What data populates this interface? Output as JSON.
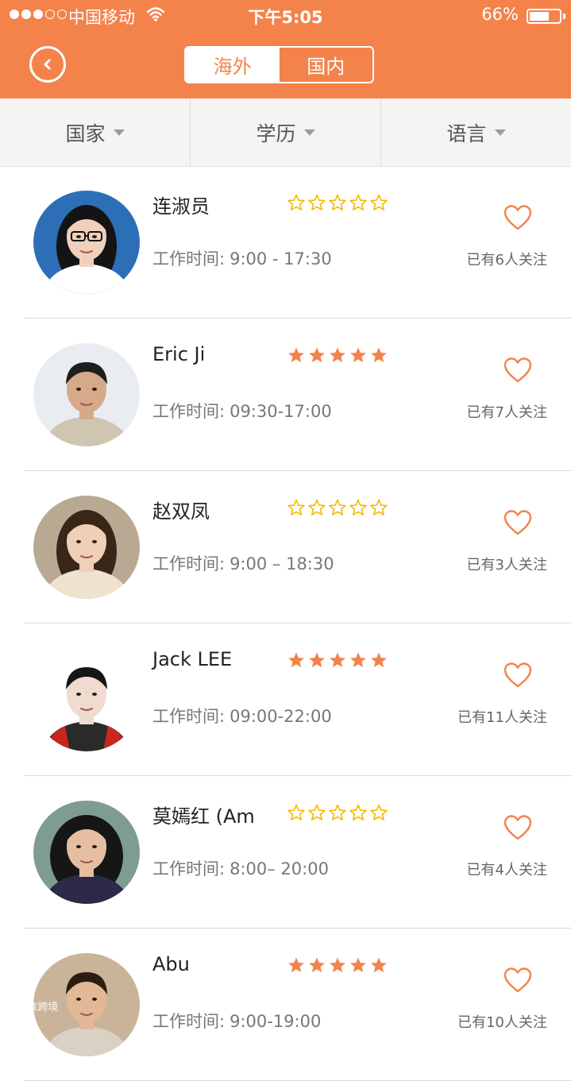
{
  "status_bar": {
    "carrier": "中国移动",
    "time": "下午5:05",
    "battery": "66%",
    "battery_level": 0.66,
    "signal_strength": 3,
    "signal_total": 5
  },
  "header": {
    "back_icon": "back-circle-icon",
    "tabs": [
      {
        "label": "海外",
        "active": true
      },
      {
        "label": "国内",
        "active": false
      }
    ]
  },
  "filters": [
    {
      "label": "国家",
      "icon": "caret-down-icon"
    },
    {
      "label": "学历",
      "icon": "caret-down-icon"
    },
    {
      "label": "语言",
      "icon": "caret-down-icon"
    }
  ],
  "colors": {
    "accent": "#f3834b",
    "star_filled": "#f3834b",
    "star_outline": "#f5b800",
    "heart": "#f3834b"
  },
  "hours_label": "工作时间:",
  "consultants": [
    {
      "name": "连淑员",
      "rating": 0,
      "hours": "9:00 - 17:30",
      "followers": "已有6人关注",
      "avatar": "woman-glasses-photo"
    },
    {
      "name": "Eric Ji",
      "rating": 5,
      "hours": "09:30-17:00",
      "followers": "已有7人关注",
      "avatar": "man-sweater-photo"
    },
    {
      "name": "赵双凤",
      "rating": 0,
      "hours": "9:00 – 18:30",
      "followers": "已有3人关注",
      "avatar": "woman-office-photo"
    },
    {
      "name": "Jack LEE",
      "rating": 5,
      "hours": "09:00-22:00",
      "followers": "已有11人关注",
      "avatar": "man-jacket-photo"
    },
    {
      "name": "莫嫣红 (Am",
      "rating": 0,
      "hours": "8:00– 20:00",
      "followers": "已有4人关注",
      "avatar": "woman-curly-hair-photo"
    },
    {
      "name": "Abu",
      "rating": 5,
      "hours": "9:00-19:00",
      "followers": "已有10人关注",
      "avatar": "man-smiling-photo"
    }
  ],
  "watermark": "大数跨境"
}
